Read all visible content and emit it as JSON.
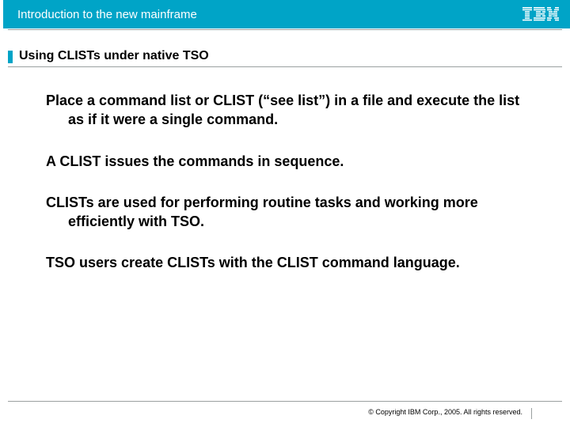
{
  "header": {
    "title": "Introduction to the new mainframe",
    "logo_name": "ibm-logo"
  },
  "slide": {
    "title": "Using CLISTs under native TSO",
    "paragraphs": [
      "Place a command list or CLIST (“see list”) in a file and execute the list as if it were a single command.",
      "A CLIST issues the commands in sequence.",
      "CLISTs are used for performing routine tasks and working more efficiently with TSO.",
      "TSO users create CLISTs with the CLIST command language."
    ]
  },
  "footer": {
    "copyright": "© Copyright IBM Corp., 2005. All rights reserved."
  }
}
